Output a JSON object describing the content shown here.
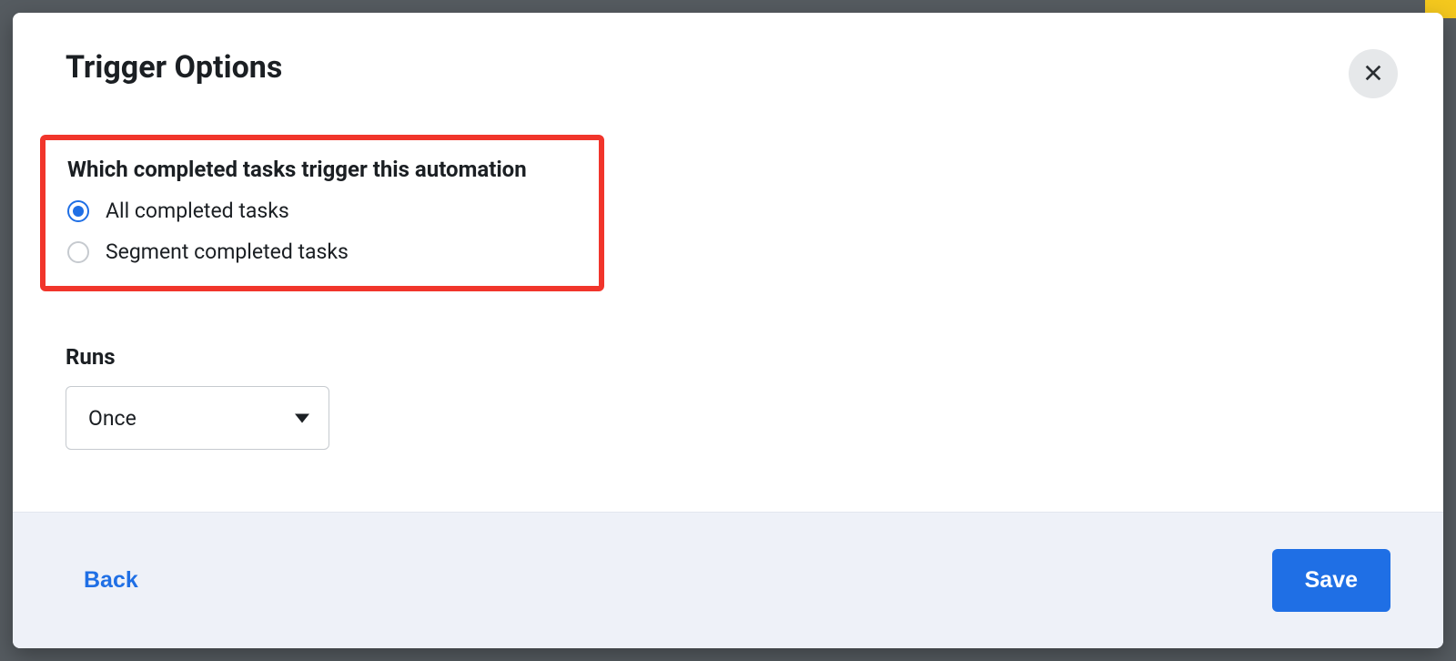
{
  "modal": {
    "title": "Trigger Options",
    "section_heading": "Which completed tasks trigger this automation",
    "radios": {
      "all": {
        "label": "All completed tasks",
        "selected": true
      },
      "segment": {
        "label": "Segment completed tasks",
        "selected": false
      }
    },
    "runs": {
      "label": "Runs",
      "selected": "Once"
    },
    "footer": {
      "back": "Back",
      "save": "Save"
    }
  }
}
